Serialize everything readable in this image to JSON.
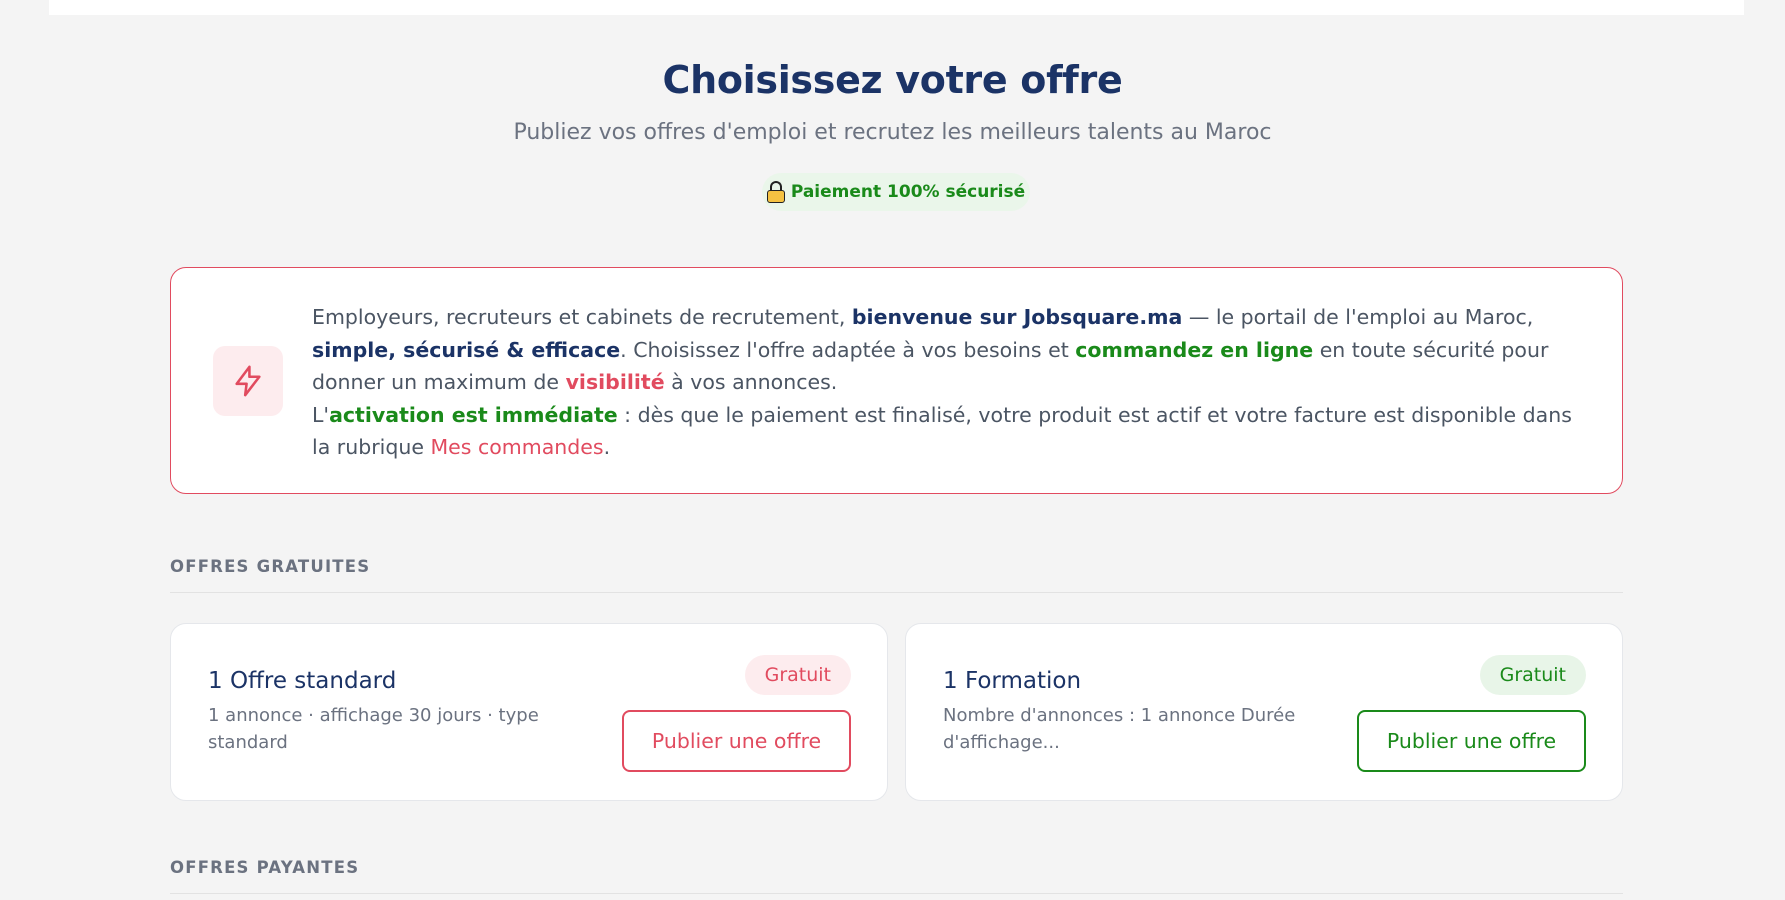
{
  "header": {
    "title": "Choisissez votre offre",
    "subtitle": "Publiez vos offres d'emploi et recrutez les meilleurs talents au Maroc",
    "secure_badge": "Paiement 100% sécurisé"
  },
  "welcome": {
    "icon": "lightning-bolt-icon",
    "line1_a": "Employeurs, recruteurs et cabinets de recrutement, ",
    "line1_b": "bienvenue sur Jobsquare.ma",
    "line1_c": " — le portail de l'emploi au Maroc, ",
    "line1_d": "simple, sécurisé & efficace",
    "line1_e": ". Choisissez l'offre adaptée à vos besoins et ",
    "line1_f": "commandez en ligne",
    "line1_g": " en toute sécurité pour donner un maximum de ",
    "line1_h": "visibilité",
    "line1_i": " à vos annonces.",
    "line2_a": "L'",
    "line2_b": "activation est immédiate",
    "line2_c": " : dès que le paiement est finalisé, votre produit est actif et votre facture est disponible dans la rubrique ",
    "line2_d": "Mes commandes",
    "line2_e": "."
  },
  "sections": {
    "free_title": "OFFRES GRATUITES",
    "paid_title": "OFFRES PAYANTES"
  },
  "offers": [
    {
      "name": "1 Offre standard",
      "description": "1 annonce · affichage 30 jours · type standard",
      "badge": "Gratuit",
      "button": "Publier une offre",
      "accent": "#e14b5f"
    },
    {
      "name": "1 Formation",
      "description": "Nombre d'annonces :  1 annonce Durée d'affichage...",
      "badge": "Gratuit",
      "button": "Publier une offre",
      "accent": "#1a8a1a"
    }
  ],
  "colors": {
    "navy": "#1b3366",
    "red": "#e14b5f",
    "green": "#1a8a1a",
    "background": "#f4f4f4"
  }
}
